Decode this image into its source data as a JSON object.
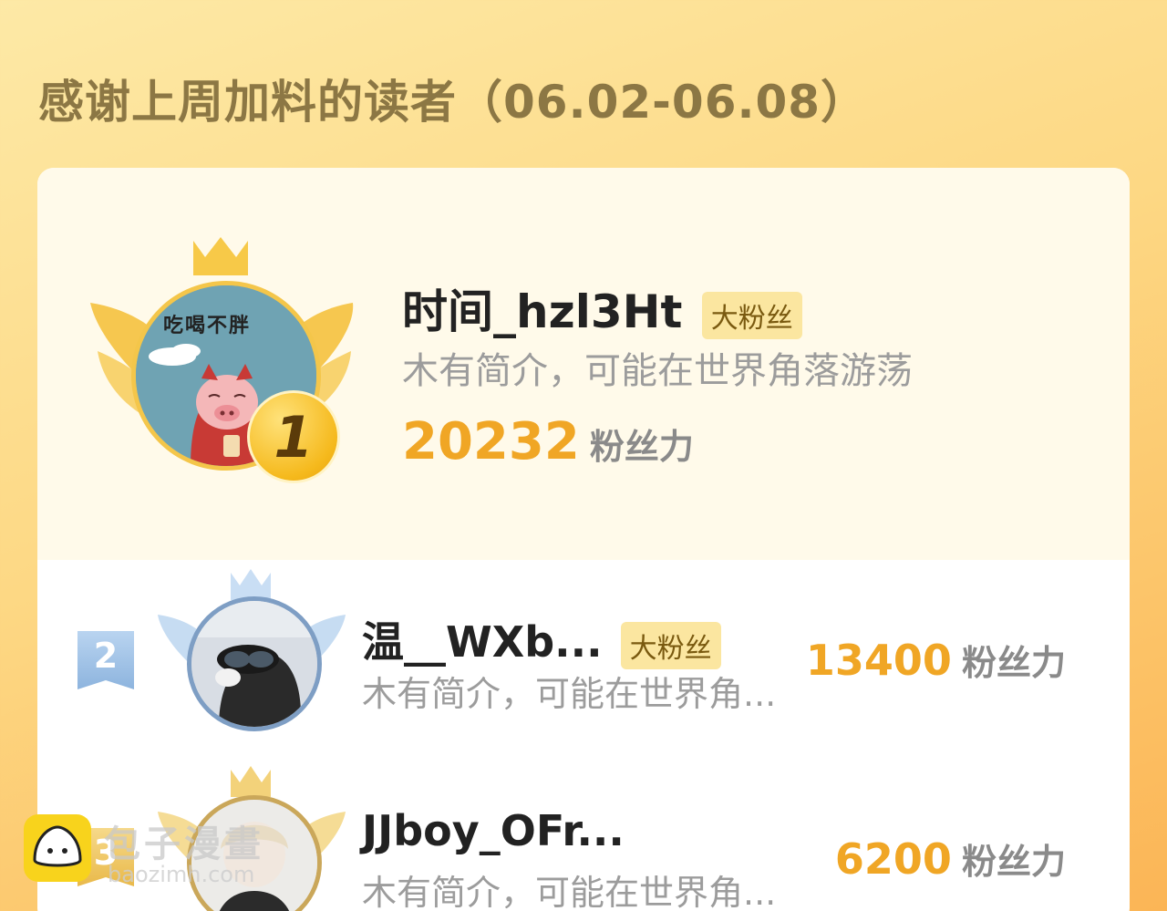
{
  "header": {
    "title": "感谢上周加料的读者（06.02-06.08）"
  },
  "readers": [
    {
      "rank": "1",
      "name": "时间_hzl3Ht",
      "badge": "大粉丝",
      "bio": "木有简介，可能在世界角落游荡",
      "score": "20232",
      "unit": "粉丝力",
      "avatar_text": "吃喝不胖",
      "crown_color": "#f7c948"
    },
    {
      "rank": "2",
      "name": "温__WXb...",
      "badge": "大粉丝",
      "bio": "木有简介，可能在世界角...",
      "score": "13400",
      "unit": "粉丝力",
      "crown_color": "#b8d3ee"
    },
    {
      "rank": "3",
      "name": "JJboy_OFr...",
      "bio": "木有简介，可能在世界角...",
      "score": "6200",
      "unit": "粉丝力",
      "crown_color": "#f3d27a"
    }
  ],
  "watermark": {
    "brand": "包子漫畫",
    "url": "baozimh.com"
  }
}
